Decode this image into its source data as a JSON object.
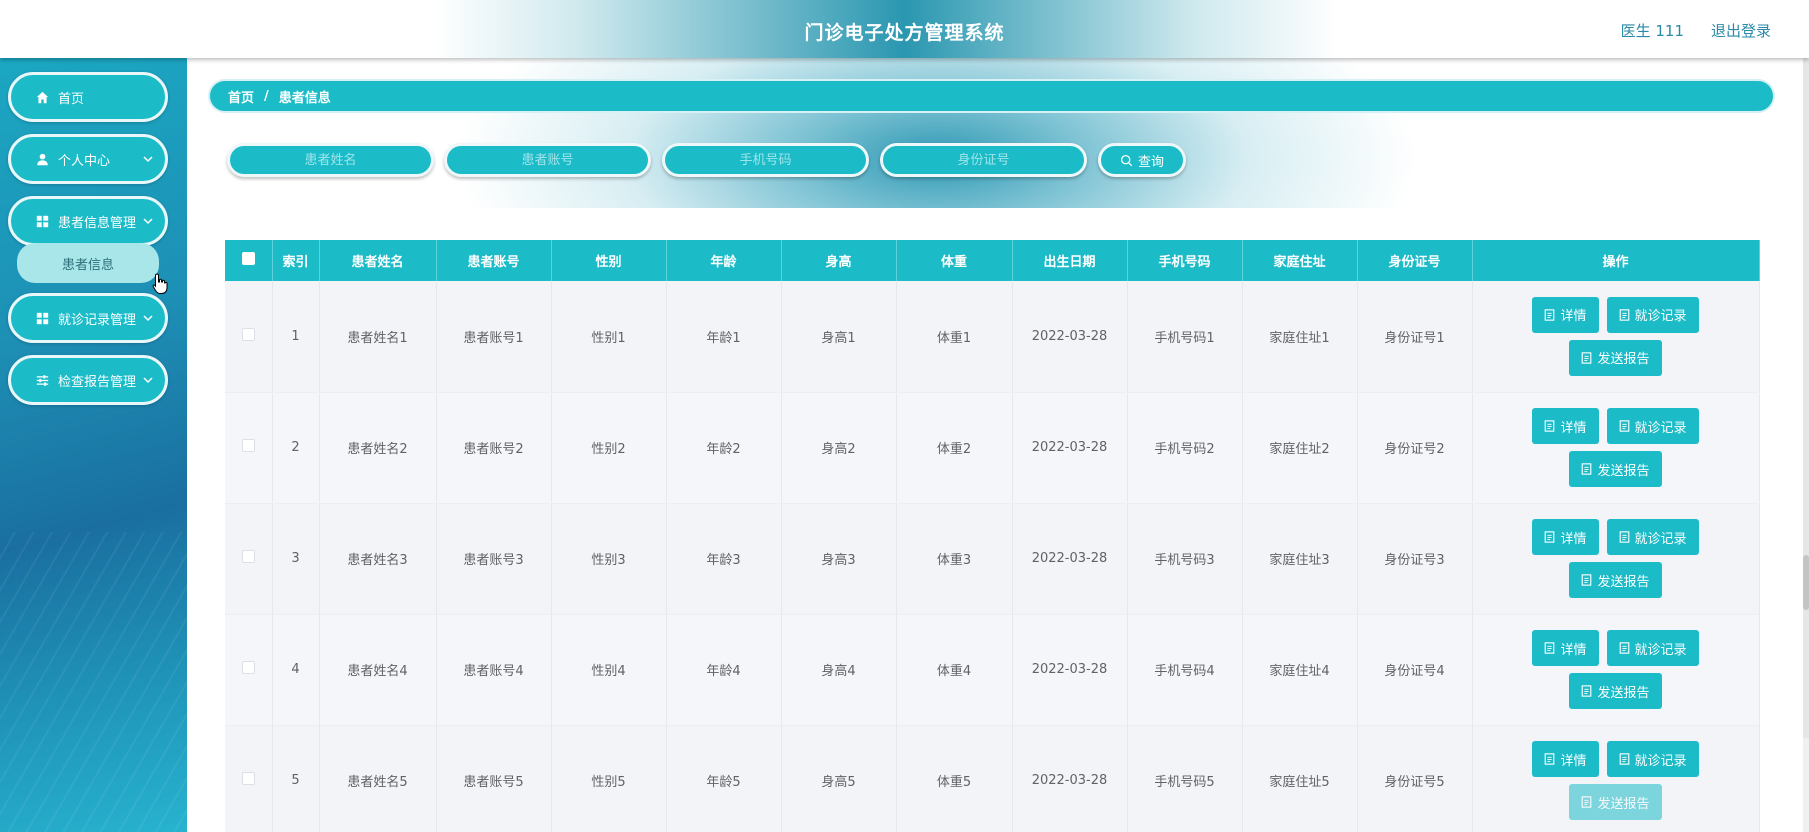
{
  "header": {
    "title": "门诊电子处方管理系统",
    "user": "医生 111",
    "logout": "退出登录"
  },
  "sidebar": {
    "items": [
      {
        "label": "首页",
        "icon": "home-icon"
      },
      {
        "label": "个人中心",
        "icon": "user-icon"
      },
      {
        "label": "患者信息管理",
        "icon": "grid-icon"
      },
      {
        "label": "就诊记录管理",
        "icon": "grid-icon"
      },
      {
        "label": "检查报告管理",
        "icon": "sliders-icon"
      }
    ],
    "submenu": {
      "label": "患者信息"
    }
  },
  "breadcrumb": {
    "home": "首页",
    "separator": "/",
    "current": "患者信息"
  },
  "search": {
    "name_placeholder": "患者姓名",
    "account_placeholder": "患者账号",
    "phone_placeholder": "手机号码",
    "idcard_placeholder": "身份证号",
    "query_label": "查询"
  },
  "table": {
    "columns": [
      "索引",
      "患者姓名",
      "患者账号",
      "性别",
      "年龄",
      "身高",
      "体重",
      "出生日期",
      "手机号码",
      "家庭住址",
      "身份证号",
      "操作"
    ],
    "rows": [
      {
        "index": "1",
        "name": "患者姓名1",
        "account": "患者账号1",
        "gender": "性别1",
        "age": "年龄1",
        "height": "身高1",
        "weight": "体重1",
        "birth": "2022-03-28",
        "phone": "手机号码1",
        "address": "家庭住址1",
        "idcard": "身份证号1"
      },
      {
        "index": "2",
        "name": "患者姓名2",
        "account": "患者账号2",
        "gender": "性别2",
        "age": "年龄2",
        "height": "身高2",
        "weight": "体重2",
        "birth": "2022-03-28",
        "phone": "手机号码2",
        "address": "家庭住址2",
        "idcard": "身份证号2"
      },
      {
        "index": "3",
        "name": "患者姓名3",
        "account": "患者账号3",
        "gender": "性别3",
        "age": "年龄3",
        "height": "身高3",
        "weight": "体重3",
        "birth": "2022-03-28",
        "phone": "手机号码3",
        "address": "家庭住址3",
        "idcard": "身份证号3"
      },
      {
        "index": "4",
        "name": "患者姓名4",
        "account": "患者账号4",
        "gender": "性别4",
        "age": "年龄4",
        "height": "身高4",
        "weight": "体重4",
        "birth": "2022-03-28",
        "phone": "手机号码4",
        "address": "家庭住址4",
        "idcard": "身份证号4"
      },
      {
        "index": "5",
        "name": "患者姓名5",
        "account": "患者账号5",
        "gender": "性别5",
        "age": "年龄5",
        "height": "身高5",
        "weight": "体重5",
        "birth": "2022-03-28",
        "phone": "手机号码5",
        "address": "家庭住址5",
        "idcard": "身份证号5"
      }
    ],
    "actions": {
      "detail": "详情",
      "visit": "就诊记录",
      "report": "发送报告"
    }
  },
  "colors": {
    "accent": "#1bbcc8",
    "link": "#2a8aa8"
  }
}
